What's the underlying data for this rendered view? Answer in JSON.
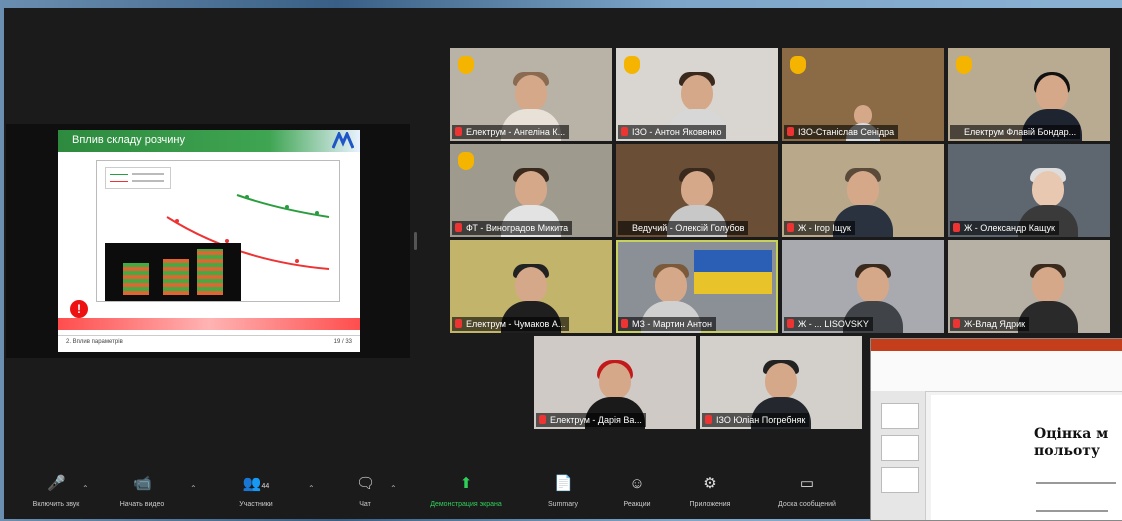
{
  "shared_screen": {
    "slide_title": "Вплив складу розчину",
    "warning_mark": "!",
    "footer_left": "2. Вплив параметрів",
    "footer_right": "19 / 33"
  },
  "participants": [
    {
      "name": "Електрум - Ангеліна К...",
      "raised_hand": true
    },
    {
      "name": "ІЗО - Антон Яковенко",
      "raised_hand": true
    },
    {
      "name": "ІЗО-Станіслав Сенідра",
      "raised_hand": true
    },
    {
      "name": "Електрум Флавій Бондар...",
      "raised_hand": true
    },
    {
      "name": "ФТ - Виноградов Микита",
      "raised_hand": true
    },
    {
      "name": "Ведучий - Олексій Голубов",
      "raised_hand": false
    },
    {
      "name": "Ж - Ігор Іщук",
      "raised_hand": false
    },
    {
      "name": "Ж - Олександр Кащук",
      "raised_hand": false
    },
    {
      "name": "Електрум - Чумаков А...",
      "raised_hand": false
    },
    {
      "name": "МЗ - Мартин Антон",
      "raised_hand": false
    },
    {
      "name": "Ж - ... LISOVSKY",
      "raised_hand": false
    },
    {
      "name": "Ж-Влад Ядрик",
      "raised_hand": false
    },
    {
      "name": "Електрум - Дарія Ва...",
      "raised_hand": false
    },
    {
      "name": "ІЗО Юліан Погребняк",
      "raised_hand": false
    }
  ],
  "powerpoint": {
    "title_line1": "Оцінка м",
    "title_line2": "польоту"
  },
  "toolbar": {
    "audio": "Включить звук",
    "video": "Начать видео",
    "participants": "Участники",
    "participants_count": "44",
    "chat": "Чат",
    "share": "Демонстрация экрана",
    "summary": "Summary",
    "reactions": "Реакции",
    "apps": "Приложения",
    "whiteboard": "Доска сообщений"
  },
  "colors": {
    "share_active": "#2fd05a",
    "mic_muted": "#e33",
    "active_speaker_border": "#c8d25a"
  }
}
